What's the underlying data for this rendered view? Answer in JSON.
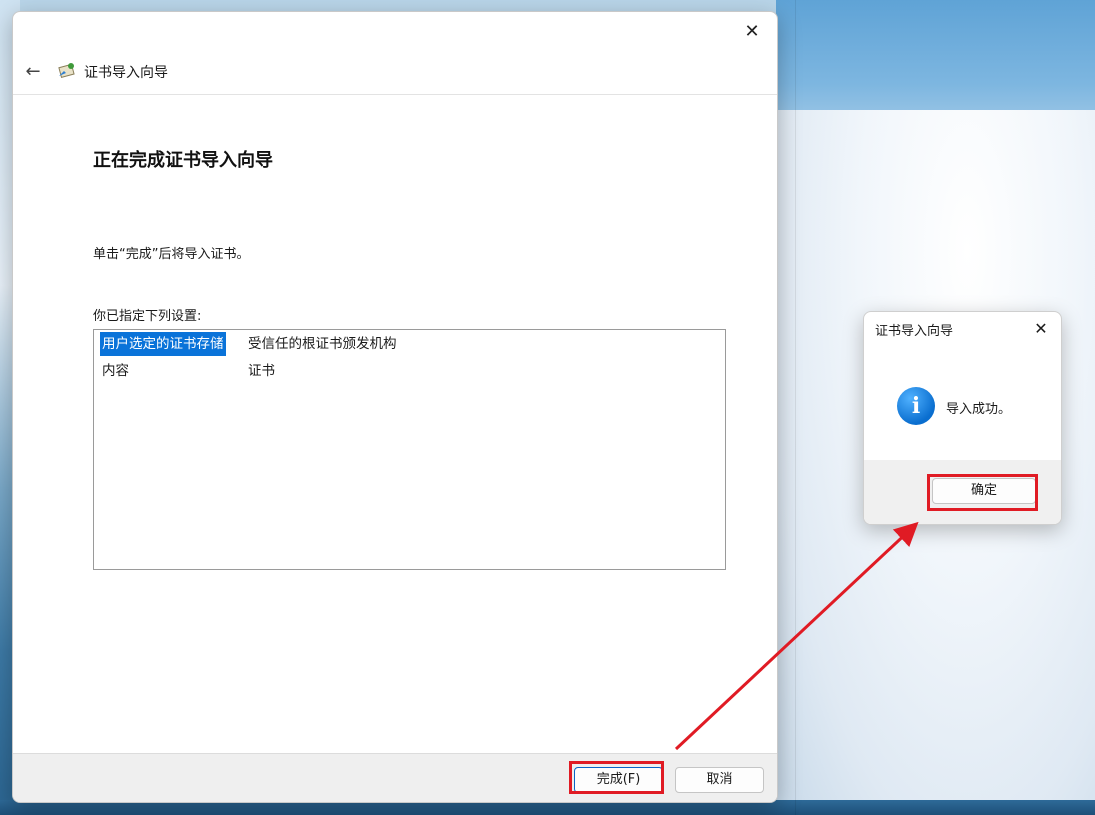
{
  "wizard": {
    "close_symbol": "✕",
    "back_symbol": "←",
    "header_title": "证书导入向导",
    "heading": "正在完成证书导入向导",
    "instruction": "单击“完成”后将导入证书。",
    "settings_label": "你已指定下列设置:",
    "settings": [
      {
        "key": "用户选定的证书存储",
        "value": "受信任的根证书颁发机构"
      },
      {
        "key": "内容",
        "value": "证书"
      }
    ],
    "finish_button": "完成(F)",
    "cancel_button": "取消"
  },
  "dialog": {
    "title": "证书导入向导",
    "close_symbol": "✕",
    "info_glyph": "i",
    "message": "导入成功。",
    "ok_button": "确定"
  },
  "colors": {
    "highlight": "#e01b24",
    "selection": "#0a73d9"
  }
}
